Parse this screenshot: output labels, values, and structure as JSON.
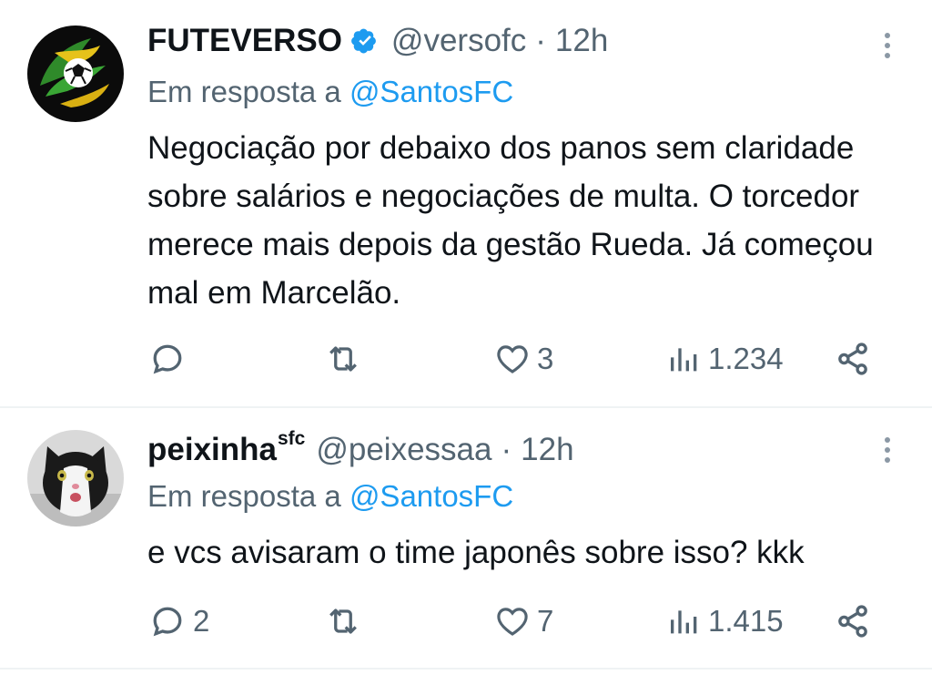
{
  "tweets": [
    {
      "name": "FUTEVERSO",
      "name_sup": "",
      "verified": true,
      "handle": "@versofc",
      "separator": "·",
      "time": "12h",
      "reply_prefix": "Em resposta a",
      "reply_mention": "@SantosFC",
      "text": "Negociação por debaixo dos panos sem claridade sobre salários e negociações de multa. O torcedor merece mais depois da gestão Rueda. Já começou mal em Marcelão.",
      "replies": "",
      "retweets": "",
      "likes": "3",
      "views": "1.234",
      "avatar_icon": "futeverso-logo-icon"
    },
    {
      "name": "peixinha",
      "name_sup": "sfc",
      "verified": false,
      "handle": "@peixessaa",
      "separator": "·",
      "time": "12h",
      "reply_prefix": "Em resposta a",
      "reply_mention": "@SantosFC",
      "text": "e vcs avisaram o time japonês sobre isso? kkk",
      "replies": "2",
      "retweets": "",
      "likes": "7",
      "views": "1.415",
      "avatar_icon": "cat-avatar-icon"
    }
  ],
  "colors": {
    "text": "#0f1419",
    "secondary": "#536471",
    "accent": "#1d9bf0",
    "divider": "#eff3f4"
  }
}
